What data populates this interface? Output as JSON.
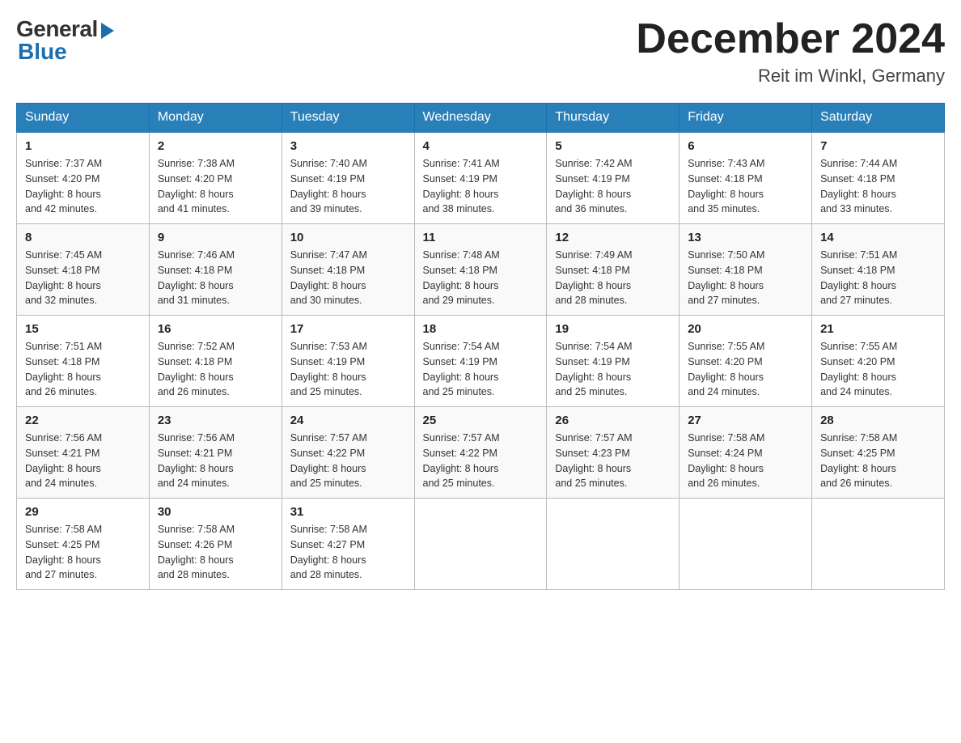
{
  "logo": {
    "general": "General",
    "blue": "Blue"
  },
  "title": "December 2024",
  "subtitle": "Reit im Winkl, Germany",
  "headers": [
    "Sunday",
    "Monday",
    "Tuesday",
    "Wednesday",
    "Thursday",
    "Friday",
    "Saturday"
  ],
  "weeks": [
    [
      {
        "day": "1",
        "sunrise": "7:37 AM",
        "sunset": "4:20 PM",
        "daylight": "8 hours and 42 minutes."
      },
      {
        "day": "2",
        "sunrise": "7:38 AM",
        "sunset": "4:20 PM",
        "daylight": "8 hours and 41 minutes."
      },
      {
        "day": "3",
        "sunrise": "7:40 AM",
        "sunset": "4:19 PM",
        "daylight": "8 hours and 39 minutes."
      },
      {
        "day": "4",
        "sunrise": "7:41 AM",
        "sunset": "4:19 PM",
        "daylight": "8 hours and 38 minutes."
      },
      {
        "day": "5",
        "sunrise": "7:42 AM",
        "sunset": "4:19 PM",
        "daylight": "8 hours and 36 minutes."
      },
      {
        "day": "6",
        "sunrise": "7:43 AM",
        "sunset": "4:18 PM",
        "daylight": "8 hours and 35 minutes."
      },
      {
        "day": "7",
        "sunrise": "7:44 AM",
        "sunset": "4:18 PM",
        "daylight": "8 hours and 33 minutes."
      }
    ],
    [
      {
        "day": "8",
        "sunrise": "7:45 AM",
        "sunset": "4:18 PM",
        "daylight": "8 hours and 32 minutes."
      },
      {
        "day": "9",
        "sunrise": "7:46 AM",
        "sunset": "4:18 PM",
        "daylight": "8 hours and 31 minutes."
      },
      {
        "day": "10",
        "sunrise": "7:47 AM",
        "sunset": "4:18 PM",
        "daylight": "8 hours and 30 minutes."
      },
      {
        "day": "11",
        "sunrise": "7:48 AM",
        "sunset": "4:18 PM",
        "daylight": "8 hours and 29 minutes."
      },
      {
        "day": "12",
        "sunrise": "7:49 AM",
        "sunset": "4:18 PM",
        "daylight": "8 hours and 28 minutes."
      },
      {
        "day": "13",
        "sunrise": "7:50 AM",
        "sunset": "4:18 PM",
        "daylight": "8 hours and 27 minutes."
      },
      {
        "day": "14",
        "sunrise": "7:51 AM",
        "sunset": "4:18 PM",
        "daylight": "8 hours and 27 minutes."
      }
    ],
    [
      {
        "day": "15",
        "sunrise": "7:51 AM",
        "sunset": "4:18 PM",
        "daylight": "8 hours and 26 minutes."
      },
      {
        "day": "16",
        "sunrise": "7:52 AM",
        "sunset": "4:18 PM",
        "daylight": "8 hours and 26 minutes."
      },
      {
        "day": "17",
        "sunrise": "7:53 AM",
        "sunset": "4:19 PM",
        "daylight": "8 hours and 25 minutes."
      },
      {
        "day": "18",
        "sunrise": "7:54 AM",
        "sunset": "4:19 PM",
        "daylight": "8 hours and 25 minutes."
      },
      {
        "day": "19",
        "sunrise": "7:54 AM",
        "sunset": "4:19 PM",
        "daylight": "8 hours and 25 minutes."
      },
      {
        "day": "20",
        "sunrise": "7:55 AM",
        "sunset": "4:20 PM",
        "daylight": "8 hours and 24 minutes."
      },
      {
        "day": "21",
        "sunrise": "7:55 AM",
        "sunset": "4:20 PM",
        "daylight": "8 hours and 24 minutes."
      }
    ],
    [
      {
        "day": "22",
        "sunrise": "7:56 AM",
        "sunset": "4:21 PM",
        "daylight": "8 hours and 24 minutes."
      },
      {
        "day": "23",
        "sunrise": "7:56 AM",
        "sunset": "4:21 PM",
        "daylight": "8 hours and 24 minutes."
      },
      {
        "day": "24",
        "sunrise": "7:57 AM",
        "sunset": "4:22 PM",
        "daylight": "8 hours and 25 minutes."
      },
      {
        "day": "25",
        "sunrise": "7:57 AM",
        "sunset": "4:22 PM",
        "daylight": "8 hours and 25 minutes."
      },
      {
        "day": "26",
        "sunrise": "7:57 AM",
        "sunset": "4:23 PM",
        "daylight": "8 hours and 25 minutes."
      },
      {
        "day": "27",
        "sunrise": "7:58 AM",
        "sunset": "4:24 PM",
        "daylight": "8 hours and 26 minutes."
      },
      {
        "day": "28",
        "sunrise": "7:58 AM",
        "sunset": "4:25 PM",
        "daylight": "8 hours and 26 minutes."
      }
    ],
    [
      {
        "day": "29",
        "sunrise": "7:58 AM",
        "sunset": "4:25 PM",
        "daylight": "8 hours and 27 minutes."
      },
      {
        "day": "30",
        "sunrise": "7:58 AM",
        "sunset": "4:26 PM",
        "daylight": "8 hours and 28 minutes."
      },
      {
        "day": "31",
        "sunrise": "7:58 AM",
        "sunset": "4:27 PM",
        "daylight": "8 hours and 28 minutes."
      },
      null,
      null,
      null,
      null
    ]
  ]
}
